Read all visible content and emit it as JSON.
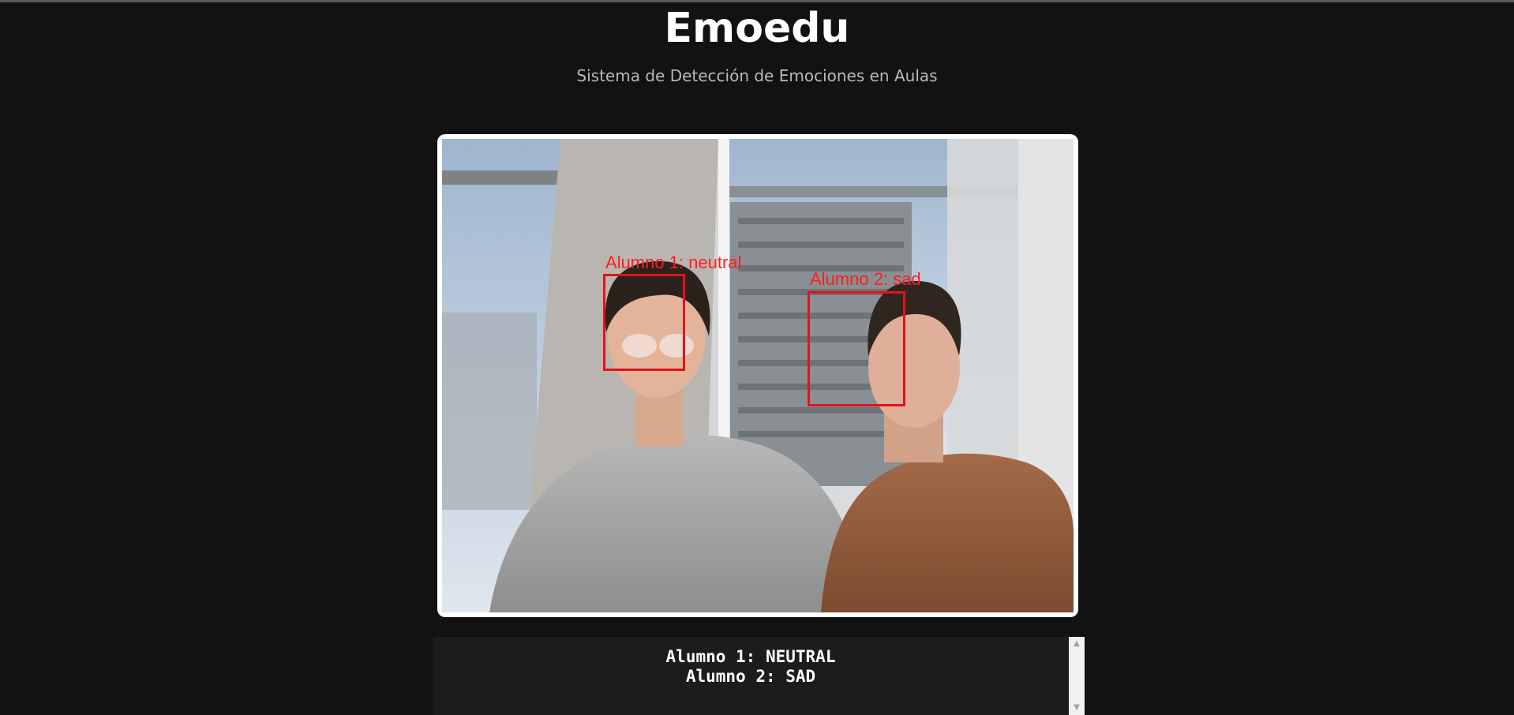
{
  "app": {
    "title": "Emoedu",
    "subtitle": "Sistema de Detección de Emociones en Aulas"
  },
  "video": {
    "detections": [
      {
        "label": "Alumno 1: neutral"
      },
      {
        "label": "Alumno 2: sad"
      }
    ],
    "box_color": "#e4121b",
    "label_color": "#ff1e1e"
  },
  "results": {
    "lines": [
      "Alumno 1: NEUTRAL",
      "Alumno 2: SAD"
    ]
  },
  "scrollbar": {
    "up_icon": "triangle-up",
    "down_icon": "triangle-down"
  }
}
